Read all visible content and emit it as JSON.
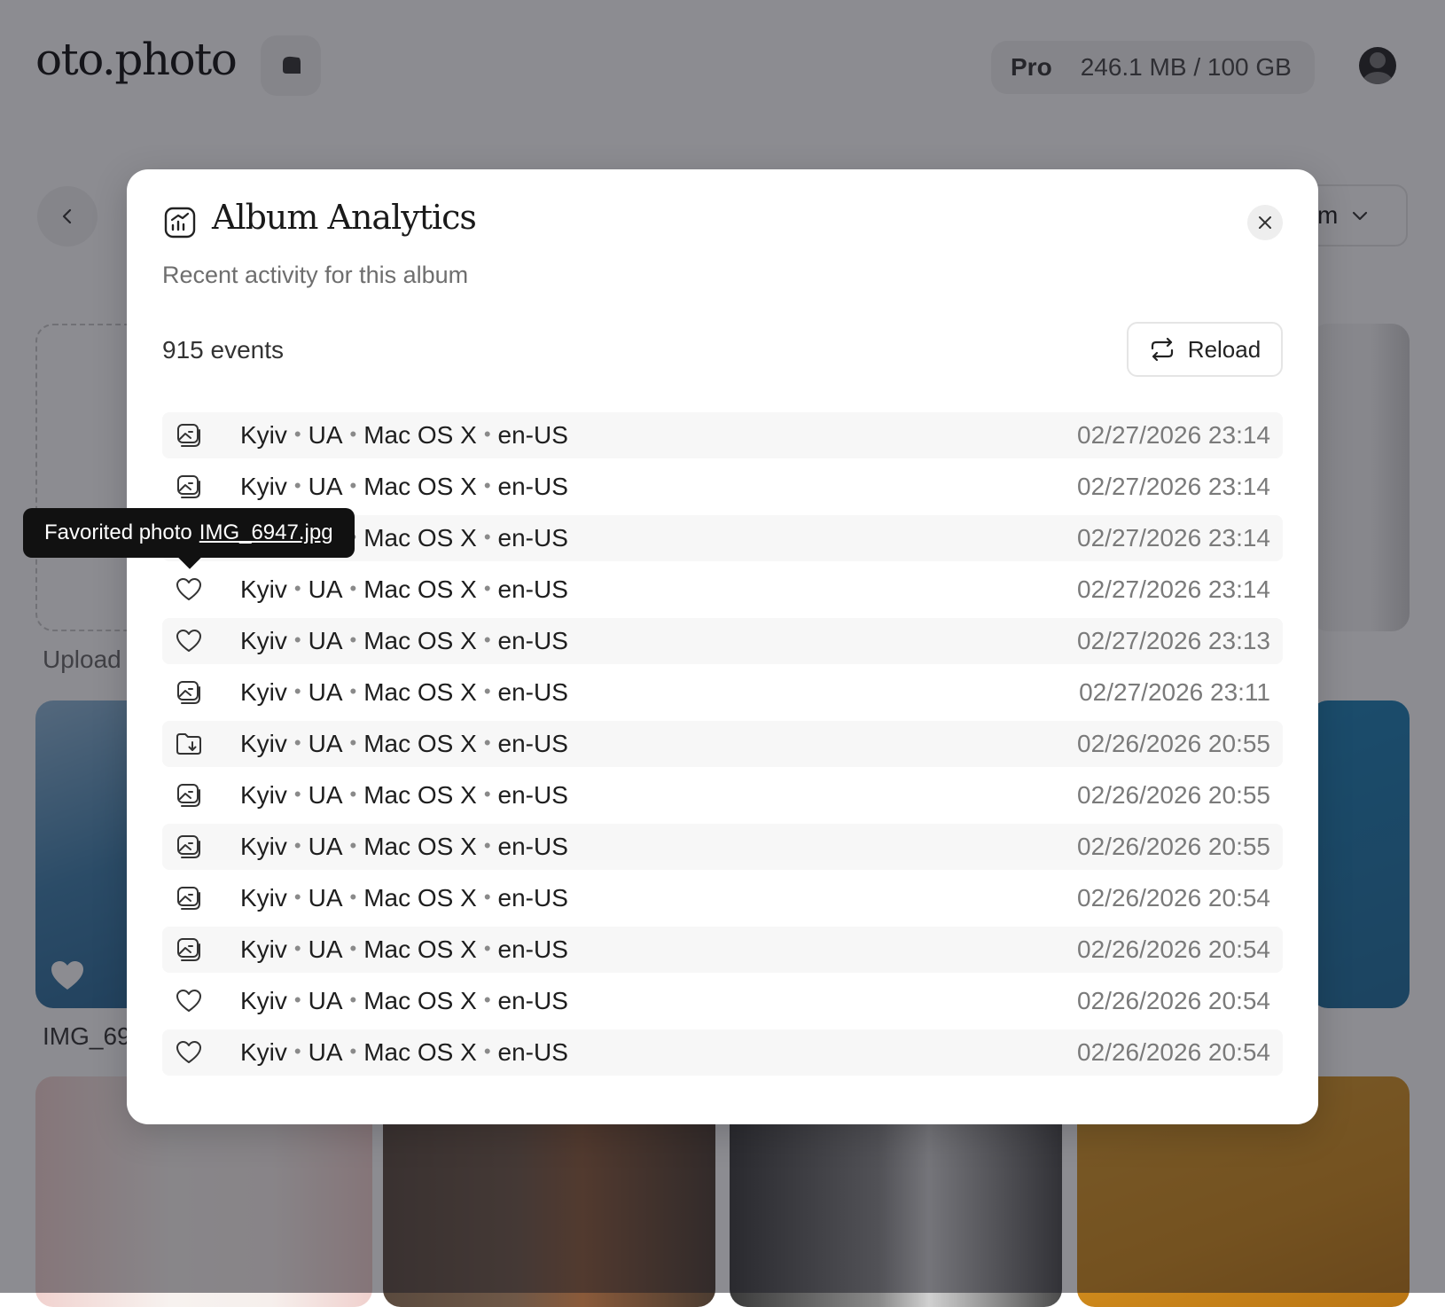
{
  "app": {
    "logo": "oto.photo",
    "plan": "Pro",
    "storage": "246.1 MB / 100 GB",
    "sort_fragment": "m",
    "upload_label": "Upload",
    "image_label": "IMG_69"
  },
  "modal": {
    "title": "Album Analytics",
    "subtitle": "Recent activity for this album",
    "events_count": "915 events",
    "reload_label": "Reload",
    "events": [
      {
        "icon": "photo-view-icon",
        "city": "Kyiv",
        "country": "UA",
        "os": "Mac OS X",
        "locale": "en-US",
        "time": "02/27/2026 23:14"
      },
      {
        "icon": "photo-view-icon",
        "city": "Kyiv",
        "country": "UA",
        "os": "Mac OS X",
        "locale": "en-US",
        "time": "02/27/2026 23:14"
      },
      {
        "icon": "heart-icon",
        "city": "Kyiv",
        "country": "UA",
        "os": "Mac OS X",
        "locale": "en-US",
        "time": "02/27/2026 23:14"
      },
      {
        "icon": "heart-icon",
        "city": "Kyiv",
        "country": "UA",
        "os": "Mac OS X",
        "locale": "en-US",
        "time": "02/27/2026 23:14"
      },
      {
        "icon": "heart-icon",
        "city": "Kyiv",
        "country": "UA",
        "os": "Mac OS X",
        "locale": "en-US",
        "time": "02/27/2026 23:13"
      },
      {
        "icon": "photo-view-icon",
        "city": "Kyiv",
        "country": "UA",
        "os": "Mac OS X",
        "locale": "en-US",
        "time": "02/27/2026 23:11"
      },
      {
        "icon": "folder-download-icon",
        "city": "Kyiv",
        "country": "UA",
        "os": "Mac OS X",
        "locale": "en-US",
        "time": "02/26/2026 20:55"
      },
      {
        "icon": "photo-view-icon",
        "city": "Kyiv",
        "country": "UA",
        "os": "Mac OS X",
        "locale": "en-US",
        "time": "02/26/2026 20:55"
      },
      {
        "icon": "photo-view-icon",
        "city": "Kyiv",
        "country": "UA",
        "os": "Mac OS X",
        "locale": "en-US",
        "time": "02/26/2026 20:55"
      },
      {
        "icon": "photo-view-icon",
        "city": "Kyiv",
        "country": "UA",
        "os": "Mac OS X",
        "locale": "en-US",
        "time": "02/26/2026 20:54"
      },
      {
        "icon": "photo-view-icon",
        "city": "Kyiv",
        "country": "UA",
        "os": "Mac OS X",
        "locale": "en-US",
        "time": "02/26/2026 20:54"
      },
      {
        "icon": "heart-icon",
        "city": "Kyiv",
        "country": "UA",
        "os": "Mac OS X",
        "locale": "en-US",
        "time": "02/26/2026 20:54"
      },
      {
        "icon": "heart-icon",
        "city": "Kyiv",
        "country": "UA",
        "os": "Mac OS X",
        "locale": "en-US",
        "time": "02/26/2026 20:54"
      }
    ]
  },
  "tooltip": {
    "prefix": "Favorited photo",
    "filename": "IMG_6947.jpg"
  },
  "colors": {
    "overlay": "#191923",
    "tooltip_bg": "#111111",
    "muted_text": "#7a7a7a"
  }
}
